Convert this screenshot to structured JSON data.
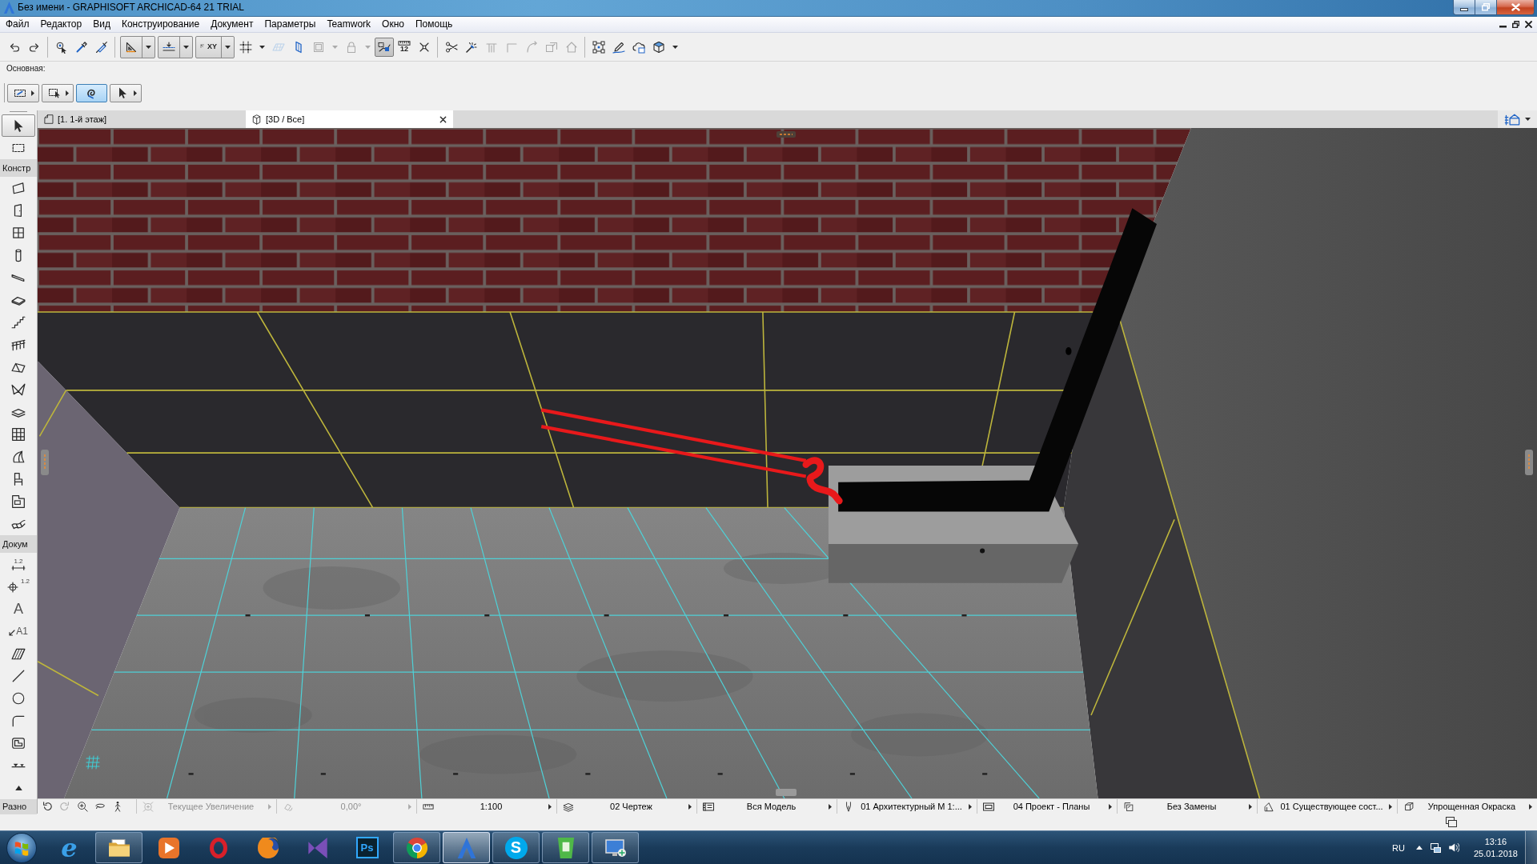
{
  "window": {
    "title": "Без имени - GRAPHISOFT ARCHICAD-64 21 TRIAL"
  },
  "menu": [
    "Файл",
    "Редактор",
    "Вид",
    "Конструирование",
    "Документ",
    "Параметры",
    "Teamwork",
    "Окно",
    "Помощь"
  ],
  "toolbar": {
    "groups": [
      {
        "buttons": [
          {
            "kind": "undo",
            "selected": false,
            "disabled": false
          },
          {
            "kind": "redo",
            "selected": false,
            "disabled": false
          }
        ]
      },
      {
        "buttons": [
          {
            "kind": "find",
            "selected": false,
            "disabled": false
          },
          {
            "kind": "eyedropper",
            "selected": false,
            "disabled": false
          },
          {
            "kind": "syringe",
            "selected": false,
            "disabled": false
          }
        ]
      },
      {
        "buttons": [
          {
            "kind": "set-square",
            "split": true,
            "menu": true,
            "selected": false,
            "disabled": false
          },
          {
            "kind": "guide",
            "split": true,
            "menu": true,
            "selected": false,
            "disabled": false
          },
          {
            "kind": "xy",
            "label": "XY",
            "split": true,
            "menu": true,
            "selected": false,
            "disabled": false
          },
          {
            "kind": "grid-snap",
            "menu": true,
            "selected": false,
            "disabled": false
          },
          {
            "kind": "plane",
            "selected": false,
            "disabled": true
          },
          {
            "kind": "vertical-plane",
            "selected": false,
            "disabled": false
          },
          {
            "kind": "frame",
            "menu": true,
            "selected": false,
            "disabled": true
          },
          {
            "kind": "lock",
            "menu": true,
            "selected": false,
            "disabled": true
          },
          {
            "kind": "trace",
            "selected": true,
            "disabled": false
          },
          {
            "kind": "ruler",
            "label": "12",
            "selected": false,
            "disabled": false
          },
          {
            "kind": "cross",
            "selected": false,
            "disabled": false
          }
        ]
      },
      {
        "buttons": [
          {
            "kind": "scissors",
            "selected": false,
            "disabled": false
          },
          {
            "kind": "wand",
            "selected": false,
            "disabled": false
          },
          {
            "kind": "trim",
            "selected": false,
            "disabled": true
          },
          {
            "kind": "corner",
            "selected": false,
            "disabled": true
          },
          {
            "kind": "curve",
            "selected": false,
            "disabled": true
          },
          {
            "kind": "offset",
            "selected": false,
            "disabled": true
          },
          {
            "kind": "house",
            "selected": false,
            "disabled": true
          }
        ]
      },
      {
        "buttons": [
          {
            "kind": "select-frame",
            "selected": false,
            "disabled": false
          },
          {
            "kind": "pencil",
            "selected": false,
            "disabled": false
          },
          {
            "kind": "cloud",
            "selected": false,
            "disabled": false
          },
          {
            "kind": "cube",
            "menu": true,
            "selected": false,
            "disabled": false
          }
        ]
      }
    ]
  },
  "toolbar2": {
    "label": "Основная:",
    "buttons": [
      {
        "kind": "dashed-select",
        "menu": true,
        "selected": false
      },
      {
        "kind": "dashed-pointer",
        "menu": true,
        "selected": false
      },
      {
        "kind": "loop",
        "selected": true
      },
      {
        "kind": "pointer",
        "menu": true,
        "selected": false
      }
    ]
  },
  "view_tabs": [
    {
      "kind": "plan",
      "label": "[1. 1-й этаж]",
      "selected": false
    },
    {
      "kind": "model",
      "label": "[3D / Все]",
      "selected": true
    }
  ],
  "toolbox": {
    "tools": [
      {
        "kind": "pointer",
        "selected": true
      },
      {
        "kind": "marquee",
        "selected": false
      }
    ],
    "sections": [
      {
        "label": "Констр",
        "tools": [
          {
            "kind": "wall",
            "selected": false
          },
          {
            "kind": "door",
            "selected": false
          },
          {
            "kind": "window",
            "selected": false
          },
          {
            "kind": "column",
            "selected": false
          },
          {
            "kind": "beam",
            "selected": false
          },
          {
            "kind": "slab",
            "selected": false
          },
          {
            "kind": "stair",
            "selected": false
          },
          {
            "kind": "railing",
            "selected": false
          },
          {
            "kind": "roof",
            "selected": false
          },
          {
            "kind": "shell",
            "selected": false
          },
          {
            "kind": "skylight",
            "selected": false
          },
          {
            "kind": "curtain-wall",
            "selected": false
          },
          {
            "kind": "morph",
            "selected": false
          },
          {
            "kind": "object",
            "selected": false
          },
          {
            "kind": "zone",
            "selected": false
          },
          {
            "kind": "mesh",
            "selected": false
          }
        ]
      },
      {
        "label": "Докум",
        "tools": [
          {
            "kind": "dimension",
            "label": "1.2",
            "selected": false
          },
          {
            "kind": "level-dimension",
            "label": "1.2",
            "selected": false
          },
          {
            "kind": "text",
            "label": "A",
            "selected": false
          },
          {
            "kind": "label",
            "label": "A1",
            "selected": false
          },
          {
            "kind": "fill",
            "selected": false
          },
          {
            "kind": "line",
            "selected": false
          },
          {
            "kind": "circle",
            "selected": false
          },
          {
            "kind": "polyline",
            "selected": false
          },
          {
            "kind": "drawing",
            "selected": false
          },
          {
            "kind": "marker",
            "selected": false
          },
          {
            "kind": "more",
            "selected": false
          }
        ]
      },
      {
        "label": "Разно"
      }
    ]
  },
  "status_bar": {
    "nav": [
      {
        "kind": "undo-view",
        "disabled": false
      },
      {
        "kind": "redo-view",
        "disabled": true
      },
      {
        "kind": "zoom-in",
        "disabled": false
      },
      {
        "kind": "orbit",
        "disabled": false
      },
      {
        "kind": "walk",
        "disabled": false
      }
    ],
    "fields": [
      {
        "kind": "zoom",
        "value": "Текущее Увеличение",
        "disabled": true
      },
      {
        "kind": "rotation",
        "value": "0,00°",
        "disabled": true
      },
      {
        "kind": "scale",
        "value": "1:100",
        "disabled": false
      },
      {
        "kind": "layers",
        "value": "02 Чертеж",
        "disabled": false
      },
      {
        "kind": "model",
        "value": "Вся Модель",
        "disabled": false
      },
      {
        "kind": "pen",
        "value": "01 Архитектурный М 1:...",
        "disabled": false
      },
      {
        "kind": "dimensions",
        "value": "04 Проект - Планы",
        "disabled": false
      },
      {
        "kind": "override",
        "value": "Без Замены",
        "disabled": false
      },
      {
        "kind": "renovation",
        "value": "01 Существующее сост...",
        "disabled": false
      },
      {
        "kind": "display",
        "value": "Упрощенная Окраска",
        "disabled": false
      }
    ]
  },
  "taskbar": {
    "apps": [
      {
        "kind": "browser",
        "label": "e",
        "open": false,
        "selected": false
      },
      {
        "kind": "folder",
        "open": true,
        "selected": false
      },
      {
        "kind": "media",
        "open": false,
        "selected": false
      },
      {
        "kind": "ring",
        "open": false,
        "selected": false
      },
      {
        "kind": "globe",
        "open": false,
        "selected": false
      },
      {
        "kind": "ribbon",
        "open": false,
        "selected": false
      },
      {
        "kind": "ps",
        "label": "Ps",
        "open": false,
        "selected": false
      },
      {
        "kind": "chrome",
        "open": true,
        "selected": false
      },
      {
        "kind": "arch",
        "open": true,
        "selected": true
      },
      {
        "kind": "skype",
        "label": "S",
        "open": true,
        "selected": false
      },
      {
        "kind": "cup",
        "open": true,
        "selected": false
      },
      {
        "kind": "monitor",
        "open": true,
        "selected": false
      }
    ],
    "tray": {
      "language": "RU",
      "time": "13:16",
      "date": "25.01.2018"
    }
  }
}
